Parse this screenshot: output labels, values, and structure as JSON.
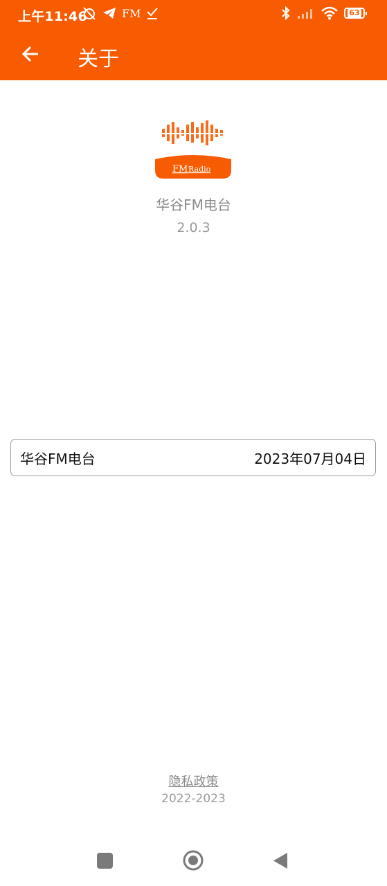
{
  "status_bar": {
    "time": "上午11:46",
    "fm_label": "FM",
    "battery_level": "63",
    "icons": [
      "alarm-off-icon",
      "telegram-icon",
      "fm-icon",
      "download-done-icon",
      "bluetooth-icon",
      "signal-icon",
      "wifi-icon",
      "battery-icon"
    ]
  },
  "app_bar": {
    "title": "关于",
    "back_icon": "arrow-back-icon",
    "background_color": "#F75C03"
  },
  "logo": {
    "text_fm": "FM",
    "text_radio": "Radio",
    "accent_color": "#F75C03"
  },
  "app_info": {
    "name": "华谷FM电台",
    "version": "2.0.3"
  },
  "info_card": {
    "name": "华谷FM电台",
    "date": "2023年07月04日"
  },
  "footer": {
    "privacy_label": "隐私政策",
    "copyright": "2022-2023"
  },
  "nav_bar": {
    "icons": [
      "recent-apps-icon",
      "home-icon",
      "back-icon"
    ]
  }
}
